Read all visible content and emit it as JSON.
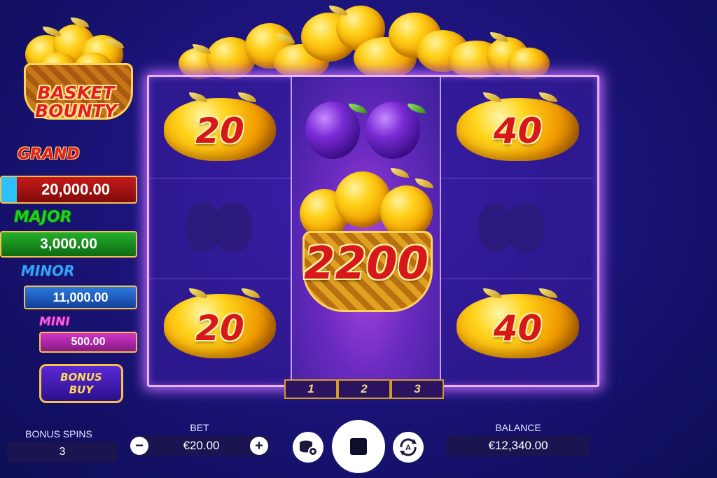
{
  "logo": {
    "line1": "BASKET",
    "line2": "BOUNTY"
  },
  "jackpots": [
    {
      "label": "GRAND",
      "value": "20,000.00",
      "label_color": "#e02020",
      "box_color": "#b01010"
    },
    {
      "label": "MAJOR",
      "value": "3,000.00",
      "label_color": "#1fbf1f",
      "box_color": "#12841a"
    },
    {
      "label": "MINOR",
      "value": "11,000.00",
      "label_color": "#2a8cff",
      "box_color": "#1a5fc8"
    },
    {
      "label": "MINI",
      "value": "500.00",
      "label_color": "#e040e0",
      "box_color": "#b0209f"
    }
  ],
  "bonus_buy": {
    "line1": "BONUS",
    "line2": "BUY"
  },
  "reels": {
    "top_left": "20",
    "top_right": "40",
    "center_basket": "2200",
    "bottom_left": "20",
    "bottom_right": "40",
    "top_middle_symbol": "plum-icon",
    "mid_left_symbol": "apple-silhouette-icon",
    "mid_right_symbol": "apple-silhouette-icon",
    "tabs": [
      "1",
      "2",
      "3"
    ]
  },
  "bottom": {
    "bonus_spins_label": "BONUS SPINS",
    "bonus_spins_value": "3",
    "bet_label": "BET",
    "bet_value": "€20.00",
    "minus": "−",
    "plus": "+",
    "balance_label": "BALANCE",
    "balance_value": "€12,340.00"
  },
  "colors": {
    "bg_top": "#3a1fb0",
    "bg_bottom": "#0d0d55",
    "frame_glow": "#c06bff",
    "number_red": "#d71818",
    "gold": "#ffd11a"
  }
}
